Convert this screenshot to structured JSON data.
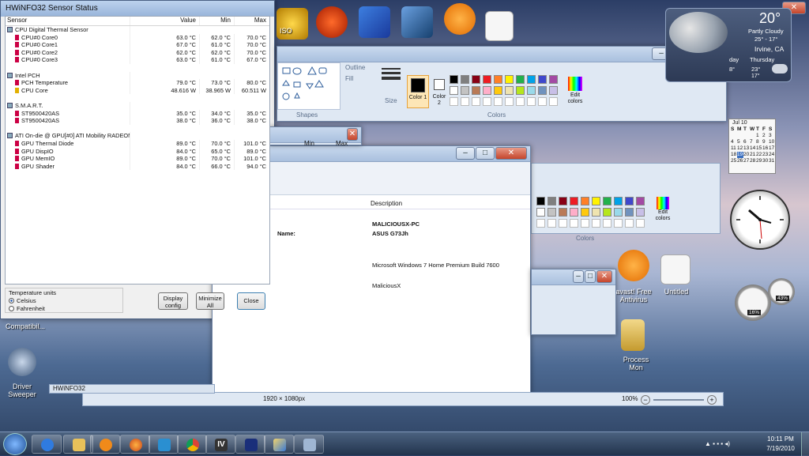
{
  "hwinfo": {
    "title": "HWiNFO32 Sensor Status",
    "columns": [
      "Sensor",
      "Value",
      "Min",
      "Max"
    ],
    "groups": [
      {
        "name": "CPU Digital Thermal Sensor",
        "rows": [
          [
            "CPU#0 Core0",
            "63.0 °C",
            "62.0 °C",
            "70.0 °C"
          ],
          [
            "CPU#0 Core1",
            "67.0 °C",
            "61.0 °C",
            "70.0 °C"
          ],
          [
            "CPU#0 Core2",
            "62.0 °C",
            "62.0 °C",
            "70.0 °C"
          ],
          [
            "CPU#0 Core3",
            "63.0 °C",
            "61.0 °C",
            "67.0 °C"
          ]
        ]
      },
      {
        "name": "Intel PCH",
        "rows": [
          [
            "PCH Temperature",
            "79.0 °C",
            "73.0 °C",
            "80.0 °C"
          ],
          [
            "CPU Core",
            "48.616 W",
            "38.965 W",
            "60.511 W"
          ]
        ]
      },
      {
        "name": "S.M.A.R.T.",
        "rows": [
          [
            "ST9500420AS",
            "35.0 °C",
            "34.0 °C",
            "35.0 °C"
          ],
          [
            "ST9500420AS",
            "38.0 °C",
            "36.0 °C",
            "38.0 °C"
          ]
        ]
      },
      {
        "name": "ATI On-die @ GPU[#0] ATI Mobility RADEON HD 5870...",
        "rows": [
          [
            "GPU Thermal Diode",
            "89.0 °C",
            "70.0 °C",
            "101.0 °C"
          ],
          [
            "GPU DispIO",
            "84.0 °C",
            "65.0 °C",
            "89.0 °C"
          ],
          [
            "GPU MemIO",
            "89.0 °C",
            "70.0 °C",
            "101.0 °C"
          ],
          [
            "GPU Shader",
            "84.0 °C",
            "66.0 °C",
            "94.0 °C"
          ]
        ]
      }
    ],
    "temp_units": {
      "label": "Temperature units",
      "options": [
        "Celsius",
        "Fahrenheit"
      ],
      "selected": "Celsius"
    },
    "buttons": {
      "display_config": "Display config",
      "minimize_all": "Minimize All",
      "close": "Close"
    },
    "taskbar_caption": "HWiNFO32"
  },
  "paint": {
    "outline": "Outline",
    "fill": "Fill",
    "size": "Size",
    "color1": "Color 1",
    "color2": "Color 2",
    "edit_colors": "Edit colors",
    "shapes_group": "Shapes",
    "colors_group": "Colors",
    "palette": [
      "#000000",
      "#7f7f7f",
      "#880015",
      "#ed1c24",
      "#ff7f27",
      "#fff200",
      "#22b14c",
      "#00a2e8",
      "#3f48cc",
      "#a349a4",
      "#ffffff",
      "#c3c3c3",
      "#b97a57",
      "#ffaec9",
      "#ffc90e",
      "#efe4b0",
      "#b5e61d",
      "#99d9ea",
      "#7092be",
      "#c8bfe7"
    ],
    "status_dims": "1920 × 1080px",
    "zoom": "100%"
  },
  "explorer": {
    "header_description": "Description",
    "fields": [
      {
        "label": "",
        "value": "MALICIOUSX-PC"
      },
      {
        "label": "Name:",
        "value": "ASUS G73Jh"
      },
      {
        "label": "",
        "value": "Microsoft Windows 7 Home Premium Build 7600"
      },
      {
        "label": "",
        "value": "MaliciousX"
      }
    ]
  },
  "ghost": {
    "min": "Min",
    "max": "Max"
  },
  "desktop": {
    "icons": [
      {
        "name": "Driver Sweeper",
        "label": "Driver\nSweeper"
      },
      {
        "name": "Compatibility",
        "label": "Compatibil..."
      }
    ],
    "inner_labels": [
      "avast! Free Antivirus",
      "Untitled",
      "Process Mon",
      "ISO"
    ]
  },
  "weather": {
    "temp": "20°",
    "condition": "Partly Cloudy",
    "range": "25° - 17°",
    "location": "Irvine, CA",
    "day": "Thursday",
    "day_hi": "23°",
    "day_lo": "17°",
    "prev_day": "day",
    "prev_hi": "8°"
  },
  "calendar": {
    "month": "Jul 10",
    "days": [
      "S",
      "M",
      "T",
      "W",
      "T",
      "F",
      "S"
    ],
    "dates": [
      "",
      "",
      "",
      "",
      "1",
      "2",
      "3",
      "4",
      "5",
      "6",
      "7",
      "8",
      "9",
      "10",
      "11",
      "12",
      "13",
      "14",
      "15",
      "16",
      "17",
      "18",
      "19",
      "20",
      "21",
      "22",
      "23",
      "24",
      "25",
      "26",
      "27",
      "28",
      "29",
      "30",
      "31"
    ]
  },
  "meters": {
    "cpu": "16%",
    "mem": "43%"
  },
  "taskbar": {
    "time": "10:11 PM",
    "date": "7/19/2010"
  }
}
